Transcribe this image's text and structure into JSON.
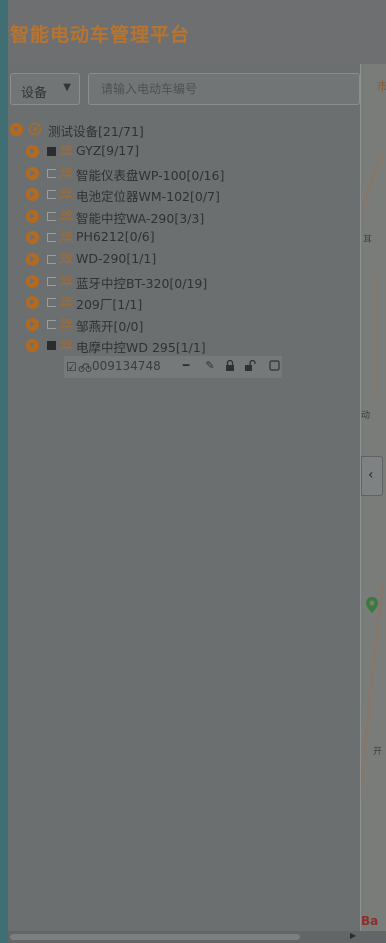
{
  "app": {
    "title": "智能电动车管理平台"
  },
  "search": {
    "device_select": "设备",
    "placeholder": "请输入电动车编号"
  },
  "tree": {
    "root": {
      "label": "测试设备[21/71]"
    },
    "groups": [
      {
        "label": "GYZ[9/17]"
      },
      {
        "label": "智能仪表盘WP-100[0/16]"
      },
      {
        "label": "电池定位器WM-102[0/7]"
      },
      {
        "label": "智能中控WA-290[3/3]"
      },
      {
        "label": "PH6212[0/6]"
      },
      {
        "label": "WD-290[1/1]"
      },
      {
        "label": "蓝牙中控BT-320[0/19]"
      },
      {
        "label": "209厂[1/1]"
      },
      {
        "label": "邹燕开[0/0]"
      },
      {
        "label": "电摩中控WD 295[1/1]"
      }
    ],
    "selected_device": {
      "label": "009134748"
    }
  },
  "map": {
    "tab_text": "市",
    "collapse_glyph": "‹",
    "logo": "Ba"
  },
  "colors": {
    "accent": "#b8742e",
    "expander": "#b36a1f"
  },
  "icons": {
    "expander": "chevron-circle-icon",
    "group": "group-people-icon",
    "device": "ebike-icon",
    "edit": "edit-icon",
    "lock": "lock-icon",
    "unlock": "unlock-icon"
  }
}
